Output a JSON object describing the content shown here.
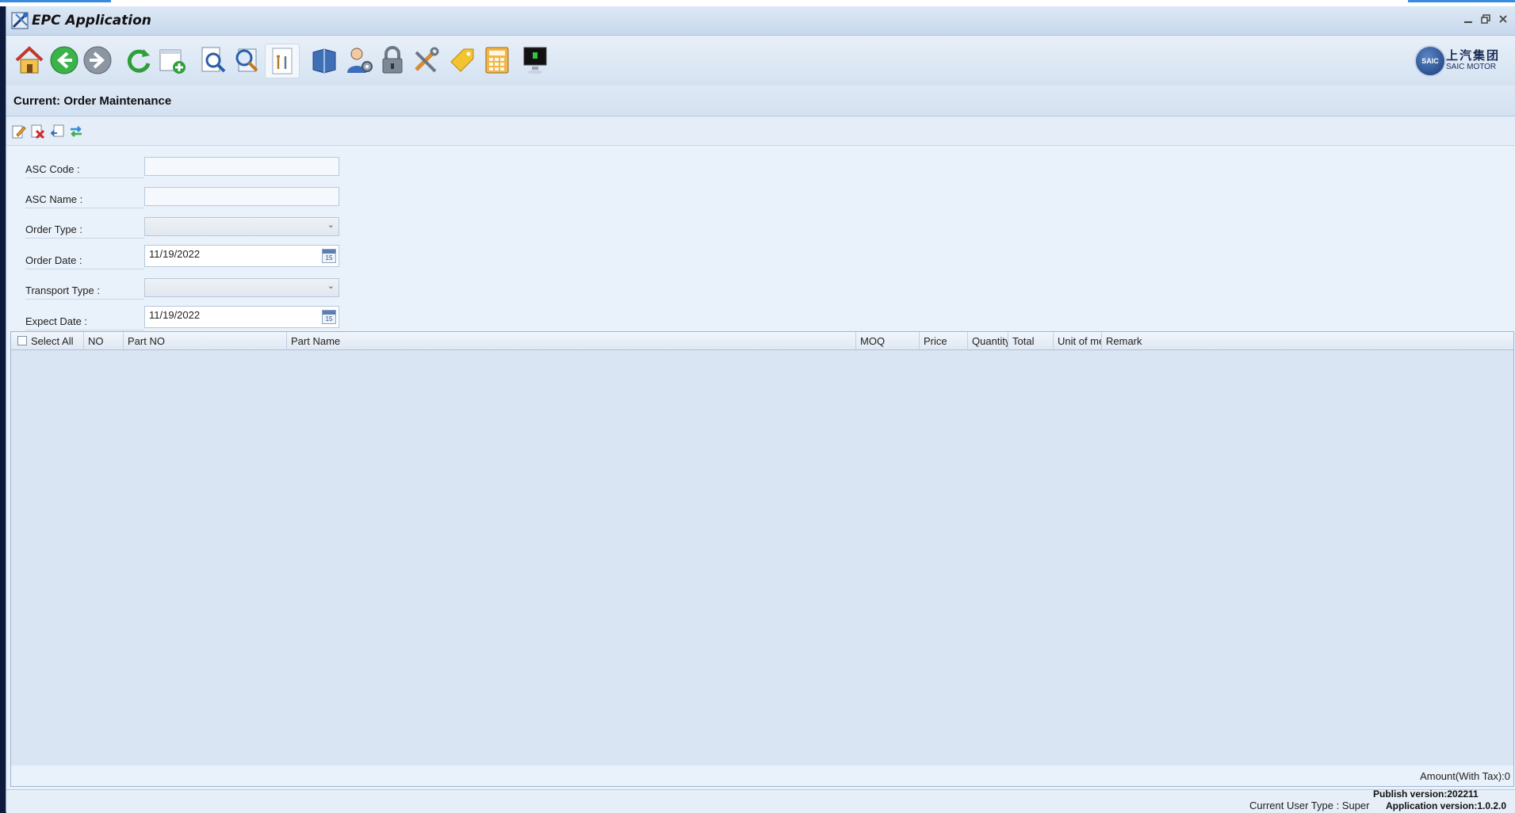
{
  "window": {
    "title": "EPC Application",
    "controls": [
      "minimize-icon",
      "restore-icon",
      "close-icon"
    ]
  },
  "toolbar": {
    "icons": [
      "home-icon",
      "back-icon",
      "forward-icon",
      "refresh-icon",
      "new-page-icon",
      "search-document-icon",
      "magnify-icon",
      "tools-document-icon",
      "book-icon",
      "user-settings-icon",
      "lock-icon",
      "tools-icon",
      "tag-icon",
      "calculator-icon",
      "monitor-icon"
    ]
  },
  "brand": {
    "badge": "SAIC",
    "chinese": "上汽集团",
    "english": "SAIC MOTOR"
  },
  "page": {
    "title": "Current: Order Maintenance"
  },
  "actions": [
    "edit-icon",
    "delete-icon",
    "import-icon",
    "transfer-icon"
  ],
  "form": {
    "asc_code_label": "ASC Code :",
    "asc_code_value": "",
    "asc_name_label": "ASC Name :",
    "asc_name_value": "",
    "order_type_label": "Order Type :",
    "order_type_value": "",
    "order_date_label": "Order Date :",
    "order_date_value": "11/19/2022",
    "transport_type_label": "Transport Type :",
    "transport_type_value": "",
    "expect_date_label": "Expect Date :",
    "expect_date_value": "11/19/2022",
    "calendar_day": "15"
  },
  "grid": {
    "select_all": "Select All",
    "columns": [
      "NO",
      "Part NO",
      "Part Name",
      "MOQ",
      "Price",
      "Quantity",
      "Total",
      "Unit of measure",
      "Remark"
    ],
    "rows": []
  },
  "footer": {
    "amount": "Amount(With Tax):0"
  },
  "status": {
    "user_type": "Current User Type : Super",
    "publish_version": "Publish version:202211",
    "application_version": "Application version:1.0.2.0"
  },
  "colors": {
    "background": "#e9f1fa",
    "grid_body": "#d9e5f3",
    "desktop": "#0d1a3c"
  }
}
